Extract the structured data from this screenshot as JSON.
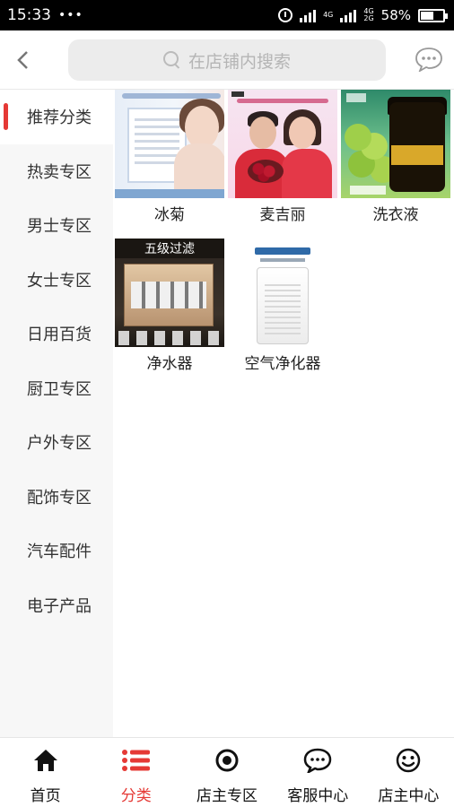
{
  "status_bar": {
    "time": "15:33",
    "dots": "•••",
    "net_top": "4G",
    "net_bottom": "4G",
    "net_2g": "2G",
    "battery": "58%"
  },
  "header": {
    "search_placeholder": "在店铺内搜索"
  },
  "sidebar": {
    "items": [
      {
        "label": "推荐分类",
        "active": true
      },
      {
        "label": "热卖专区"
      },
      {
        "label": "男士专区"
      },
      {
        "label": "女士专区"
      },
      {
        "label": "日用百货"
      },
      {
        "label": "厨卫专区"
      },
      {
        "label": "户外专区"
      },
      {
        "label": "配饰专区"
      },
      {
        "label": "汽车配件"
      },
      {
        "label": "电子产品"
      }
    ]
  },
  "products": [
    {
      "name": "冰菊",
      "image": "product-photo-skin-care"
    },
    {
      "name": "麦吉丽",
      "image": "product-photo-couple-roses"
    },
    {
      "name": "洗衣液",
      "image": "product-photo-black-jar"
    },
    {
      "name": "净水器",
      "image": "product-photo-water-purifier",
      "image_text": "五级过滤"
    },
    {
      "name": "空气净化器",
      "image": "product-photo-air-purifier"
    }
  ],
  "bottom_nav": {
    "items": [
      {
        "label": "首页",
        "icon": "home-icon"
      },
      {
        "label": "分类",
        "icon": "list-icon",
        "active": true
      },
      {
        "label": "店主专区",
        "icon": "target-icon"
      },
      {
        "label": "客服中心",
        "icon": "chat-bubble-icon"
      },
      {
        "label": "店主中心",
        "icon": "smiley-icon"
      }
    ]
  },
  "colors": {
    "accent": "#e53935",
    "sidebar_bg": "#f7f7f7",
    "search_bg": "#ececec"
  }
}
